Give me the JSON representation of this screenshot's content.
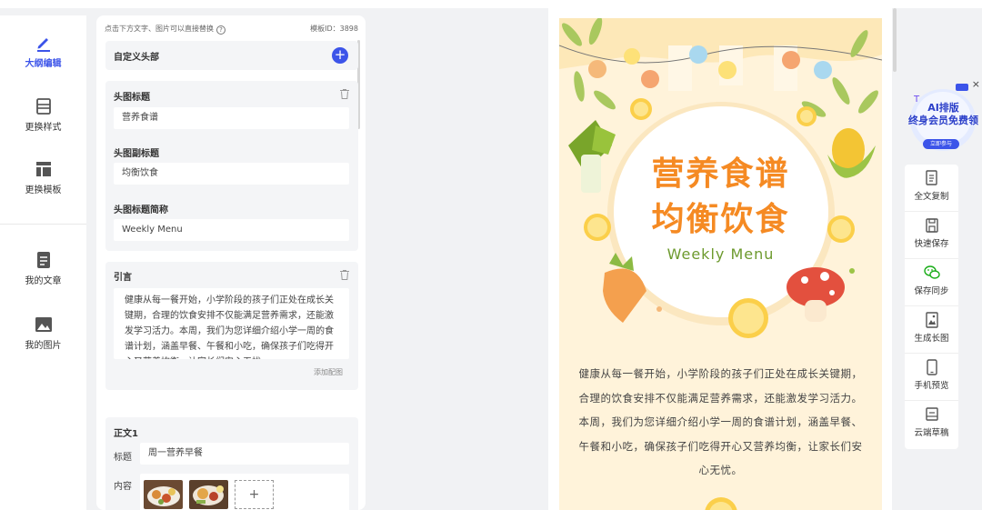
{
  "nav": {
    "items": [
      {
        "label": "大纲编辑",
        "icon": "pen-icon"
      },
      {
        "label": "更换样式",
        "icon": "style-icon"
      },
      {
        "label": "更换模板",
        "icon": "template-icon"
      },
      {
        "label": "我的文章",
        "icon": "article-icon"
      },
      {
        "label": "我的图片",
        "icon": "image-icon"
      }
    ]
  },
  "editor": {
    "hint": "点击下方文字、图片可以直接替换",
    "template_id": "模板ID：3898",
    "custom_header": "自定义头部",
    "head_title_label": "头图标题",
    "head_title_value": "营养食谱",
    "head_subtitle_label": "头图副标题",
    "head_subtitle_value": "均衡饮食",
    "head_short_label": "头图标题简称",
    "head_short_value": "Weekly Menu",
    "intro_label": "引言",
    "intro_text": "健康从每一餐开始，小学阶段的孩子们正处在成长关键期，合理的饮食安排不仅能满足营养需求，还能激发学习活力。本周，我们为您详细介绍小学一周的食谱计划，涵盖早餐、午餐和小吃，确保孩子们吃得开心又营养均衡，让家长们安心无忧。",
    "add_image": "添加配图",
    "body1_label": "正文1",
    "title_label": "标题",
    "body1_title": "周一营养早餐",
    "content_label": "内容",
    "upload_plus": "+"
  },
  "preview": {
    "title_line1": "营养食谱",
    "title_line2": "均衡饮食",
    "subtitle": "Weekly Menu",
    "body": "健康从每一餐开始，小学阶段的孩子们正处在成长关键期，合理的饮食安排不仅能满足营养需求，还能激发学习活力。本周，我们为您详细介绍小学一周的食谱计划，涵盖早餐、午餐和小吃，确保孩子们吃得开心又营养均衡，让家长们安心无忧。"
  },
  "promo": {
    "line1": "AI排版",
    "line2": "终身会员免费领",
    "button": "立即参与",
    "close": "×"
  },
  "tools": [
    {
      "label": "全文复制",
      "icon": "copy-icon"
    },
    {
      "label": "快速保存",
      "icon": "save-icon"
    },
    {
      "label": "保存同步",
      "icon": "wechat-icon"
    },
    {
      "label": "生成长图",
      "icon": "long-image-icon"
    },
    {
      "label": "手机预览",
      "icon": "phone-icon"
    },
    {
      "label": "云端草稿",
      "icon": "cloud-draft-icon"
    }
  ],
  "colors": {
    "accent": "#3c54e9",
    "poster_title": "#f58a23",
    "poster_sub": "#6d9a2e",
    "poster_bg": "#fff3da"
  }
}
